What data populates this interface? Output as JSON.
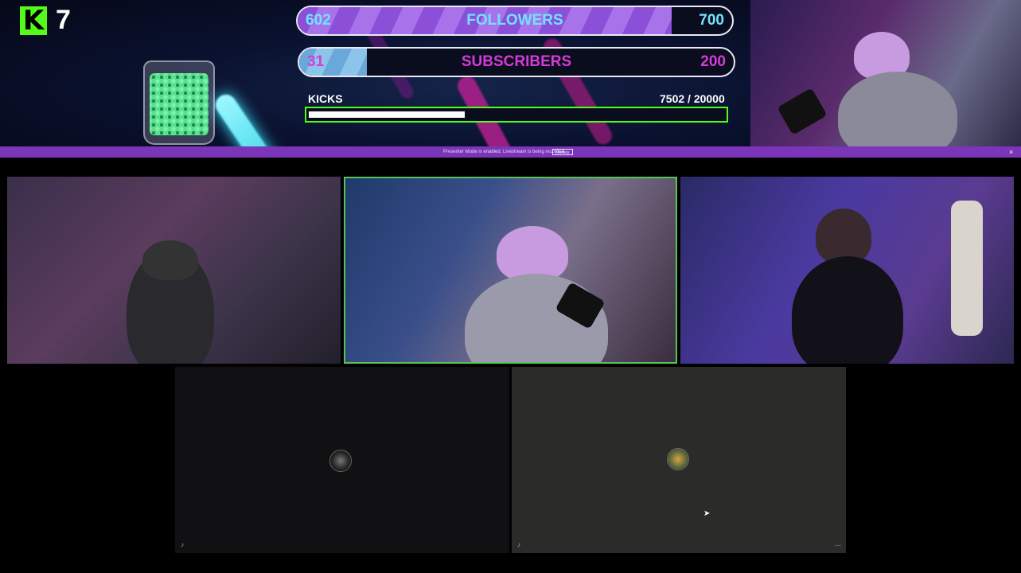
{
  "overlay": {
    "kick_count": "7",
    "followers": {
      "current": "602",
      "label": "FOLLOWERS",
      "goal": "700",
      "progress": 0.86
    },
    "subscribers": {
      "current": "31",
      "label": "SUBSCRIBERS",
      "goal": "200",
      "progress": 0.155
    },
    "kicks": {
      "label": "KICKS",
      "value": "7502  / 20000",
      "progress": 0.375
    }
  },
  "notice": {
    "text": "Presenter Mode is enabled. Livestream is being recorded.",
    "button": "Dismiss"
  },
  "icons": {
    "logo": "kick-logo-icon",
    "mic": "mic-muted-icon",
    "more": "more-options-icon",
    "close": "close-icon",
    "cursor": "mouse-cursor-icon"
  },
  "colors": {
    "kick_green": "#53fc18",
    "notice_purple": "#7b35b8",
    "active_speaker_border": "#57c25a"
  }
}
